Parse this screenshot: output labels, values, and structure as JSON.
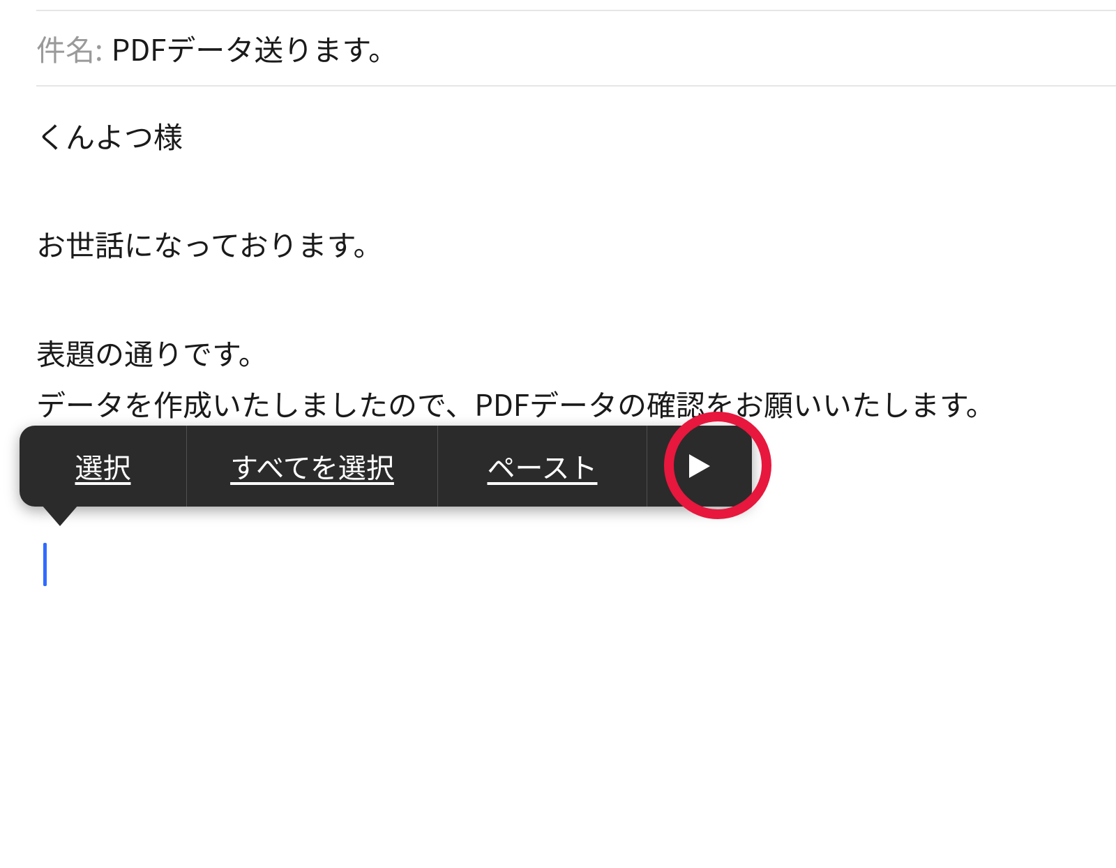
{
  "subject": {
    "label": "件名:",
    "value": "PDFデータ送ります。"
  },
  "body": {
    "line1": "くんよつ様",
    "line2": "お世話になっております。",
    "line3": "表題の通りです。",
    "line4": "データを作成いたしましたので、PDFデータの確認をお願いいたします。"
  },
  "context_menu": {
    "select": "選択",
    "select_all": "すべてを選択",
    "paste": "ペースト"
  }
}
